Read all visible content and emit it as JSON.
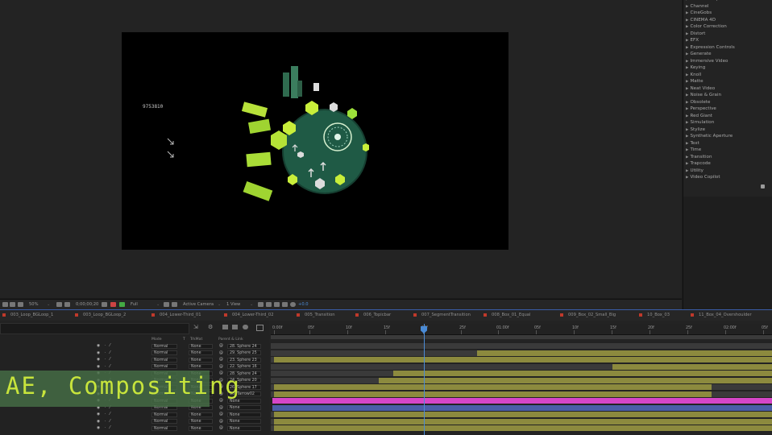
{
  "effects_panel": {
    "items": [
      "Blur & Sharpen",
      "Channel",
      "CineGobs",
      "CINEMA 4D",
      "Color Correction",
      "Distort",
      "EFX",
      "Expression Controls",
      "Generate",
      "Immersive Video",
      "Keying",
      "Knoll",
      "Matte",
      "Neat Video",
      "Noise & Grain",
      "Obsolete",
      "Perspective",
      "Red Giant",
      "Simulation",
      "Stylize",
      "Synthetic Aperture",
      "Text",
      "Time",
      "Transition",
      "Trapcode",
      "Utility",
      "Video Copilot"
    ]
  },
  "viewer": {
    "comp_number": "9753810",
    "toolbar": {
      "zoom": "50%",
      "timecode": "0;00;00;20",
      "resolution": "Full",
      "camera": "Active Camera",
      "views": "1 View",
      "exposure": "+0.0"
    }
  },
  "tabs": [
    "003_Loop_BGLoop_1",
    "003_Loop_BGLoop_2",
    "004_Lower-Third_01",
    "004_Lower-Third_02",
    "005_Transition",
    "006_Topicbar",
    "007_SegmentTransition",
    "008_Box_01_Equal",
    "009_Box_02_Small_Big",
    "10_Box_03",
    "11_Box_04_Overshoulder"
  ],
  "ruler": [
    "0:00f",
    "05f",
    "10f",
    "15f",
    "20f",
    "25f",
    "01:00f",
    "05f",
    "10f",
    "15f",
    "20f",
    "25f",
    "02:00f",
    "05f"
  ],
  "columns": {
    "mode": "Mode",
    "t": "T",
    "trkmat": "TrkMat",
    "parent": "Parent & Link"
  },
  "layers": [
    {
      "mode": "Normal",
      "trkmat": "None",
      "parent": "28. Sphere 24"
    },
    {
      "mode": "Normal",
      "trkmat": "None",
      "parent": "29. Sphere 25"
    },
    {
      "mode": "Normal",
      "trkmat": "None",
      "parent": "23. Sphere 23"
    },
    {
      "mode": "Normal",
      "trkmat": "None",
      "parent": "22. Sphere 16"
    },
    {
      "mode": "Normal",
      "trkmat": "None",
      "parent": "28. Sphere 24"
    },
    {
      "mode": "Normal",
      "trkmat": "None",
      "parent": "24. Sphere 20"
    },
    {
      "mode": "Normal",
      "trkmat": "None",
      "parent": "26. Sphere 17"
    },
    {
      "mode": "Normal",
      "trkmat": "None",
      "parent": "30. Tarrow02"
    },
    {
      "mode": "Normal",
      "trkmat": "None",
      "parent": "None"
    },
    {
      "mode": "Normal",
      "trkmat": "None",
      "parent": "None"
    },
    {
      "mode": "Normal",
      "trkmat": "None",
      "parent": "None"
    },
    {
      "mode": "Normal",
      "trkmat": "None",
      "parent": "None"
    },
    {
      "mode": "Normal",
      "trkmat": "None",
      "parent": "None"
    }
  ],
  "overlay": {
    "label": "AE, Compositing"
  },
  "colors": {
    "accent": "#4a8bd6",
    "layer_bar": "#8c8a3e",
    "pink_bar": "#d646c8",
    "blue_bar": "#4a5ea8",
    "label_text": "#c7e43c"
  }
}
